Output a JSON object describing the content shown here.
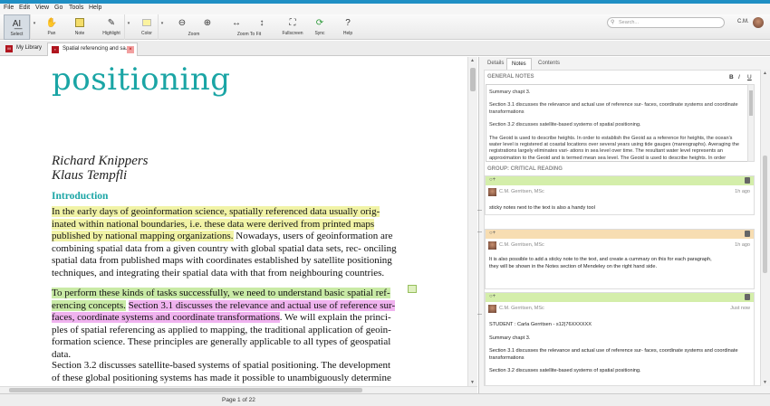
{
  "menu": {
    "file": "File",
    "edit": "Edit",
    "view": "View",
    "go": "Go",
    "tools": "Tools",
    "help": "Help"
  },
  "toolbar": {
    "select": "Select",
    "pan": "Pan",
    "note": "Note",
    "highlight": "Highlight",
    "color": "Color",
    "zoom": "Zoom",
    "zoom_to_fit": "Zoom To Fit",
    "fullscreen": "Fullscreen",
    "sync": "Sync",
    "help": "Help",
    "search_placeholder": "Search...",
    "user": "C.M."
  },
  "tabs": [
    {
      "label": "My Library",
      "icon": "M"
    },
    {
      "label": "Spatial referencing and sa...",
      "icon": "PDF"
    }
  ],
  "document": {
    "heading": "positioning",
    "authors": [
      "Richard Knippers",
      "Klaus Tempfli"
    ],
    "section": "Introduction",
    "p1_highlighted": "In the early days of geoinformation science, spatially referenced data usually orig- inated within national boundaries, i.e. these data were derived from printed maps published by national mapping organizations.",
    "p1_rest": " Nowadays, users of geoinformation are combining spatial data from a given country with global spatial data sets, rec- onciling spatial data from published maps with coordinates established by satellite positioning techniques, and integrating their spatial data with that from neighbouring countries.",
    "p2_green": "To perform these kinds of tasks successfully, we need to understand basic spatial ref- erencing concepts.",
    "p2_space": " ",
    "p2_pink": "Section 3.1 discusses the relevance and actual use of reference sur- faces, coordinate systems and coordinate transformations",
    "p2_rest": ". We will explain the princi- ples of spatial referencing as applied to mapping, the traditional application of geoin- formation science. These principles are generally applicable to all types of geospatial data.",
    "p3": "Section 3.2 discusses satellite-based systems of spatial positioning. The development of these global positioning systems has made it possible to unambiguously determine"
  },
  "status": {
    "page": "Page 1 of 22"
  },
  "panel": {
    "tabs": [
      "Details",
      "Notes",
      "Contents"
    ],
    "general_notes_header": "GENERAL NOTES",
    "format": {
      "bold": "B",
      "italic": "I",
      "underline": "U"
    },
    "general_notes": [
      "Summary chapt 3.",
      "Section 3.1 discusses the relevance and actual use of reference sur- faces, coordinate systems and coordinate transformations",
      "Section 3.2 discusses satellite-based systems of spatial positioning.",
      "The Geoid is used to describe heights. In order to establish the Geoid as a reference for heights, the ocean's water level is registered at coastal locations over several years using tide gauges (mareographs). Averaging the registrations largely eliminates vari- ations in sea level over time. The resultant water level represents an approximation to the Geoid and is termed mean sea level. The Geoid is used to describe heights. In order"
    ],
    "group_header": "GROUP: CRITICAL READING",
    "cards": [
      {
        "author": "C.M. Gerritsen, MSc",
        "time": "1h ago",
        "color": "#d4eeaa",
        "texts": [
          "sticky notes next to the text is also a handy tool"
        ]
      },
      {
        "author": "C.M. Gerritsen, MSc",
        "time": "1h ago",
        "color": "#f7ddb2",
        "texts": [
          "It is also possible to add a sticky note to the text, and create a cummary on this for each paragraph,",
          "they will be shown in the Notes section of Mendeley on the right hand side."
        ]
      },
      {
        "author": "C.M. Gerritsen, MSc",
        "time": "Just now",
        "color": "#d4eeaa",
        "texts": [
          "STUDENT : Carla Gerritsen - s12|76XXXXXX",
          "Summary chapt 3.",
          "Section 3.1 discusses the relevance and actual use of reference sur- faces, coordinate systems and coordinate transformations",
          "Section 3.2 discusses satellite-based systems of spatial positioning."
        ]
      }
    ]
  }
}
